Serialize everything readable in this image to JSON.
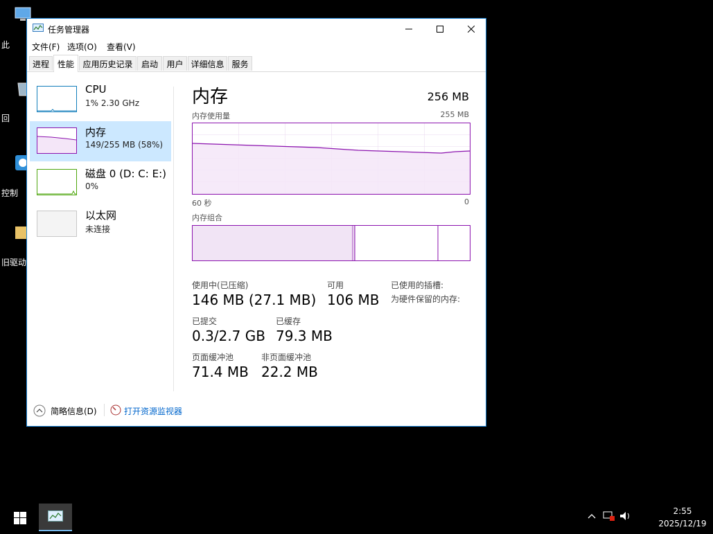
{
  "desktop": {
    "icons": [
      {
        "label": "此"
      },
      {
        "label": "回"
      },
      {
        "label": "控制"
      },
      {
        "label": "旧驱动"
      }
    ]
  },
  "window": {
    "title": "任务管理器",
    "menu": [
      "文件(F)",
      "选项(O)",
      "查看(V)"
    ],
    "tabs": [
      "进程",
      "性能",
      "应用历史记录",
      "启动",
      "用户",
      "详细信息",
      "服务"
    ],
    "active_tab": "性能"
  },
  "sidebar": {
    "items": [
      {
        "name": "CPU",
        "sub": "1% 2.30 GHz"
      },
      {
        "name": "内存",
        "sub": "149/255 MB (58%)"
      },
      {
        "name": "磁盘 0 (D: C: E:)",
        "sub": "0%"
      },
      {
        "name": "以太网",
        "sub": "未连接"
      }
    ]
  },
  "main": {
    "title": "内存",
    "total": "256 MB",
    "usage_label": "内存使用量",
    "usage_max": "255 MB",
    "time_left": "60 秒",
    "time_right": "0",
    "composition_label": "内存组合",
    "stats": {
      "in_use_label": "使用中(已压缩)",
      "in_use_value": "146 MB (27.1 MB)",
      "available_label": "可用",
      "available_value": "106 MB",
      "slots_label": "已使用的插槽:",
      "reserved_label": "为硬件保留的内存:",
      "committed_label": "已提交",
      "committed_value": "0.3/2.7 GB",
      "cached_label": "已缓存",
      "cached_value": "79.3 MB",
      "paged_label": "页面缓冲池",
      "paged_value": "71.4 MB",
      "nonpaged_label": "非页面缓冲池",
      "nonpaged_value": "22.2 MB"
    }
  },
  "footer": {
    "brief": "简略信息(D)",
    "monitor": "打开资源监视器"
  },
  "taskbar": {
    "time": "2:55",
    "date": "2025/12/19"
  },
  "colors": {
    "memory": "#8b12ae",
    "cpu": "#117dbb",
    "disk": "#4da60c",
    "accent": "#1883d7",
    "link": "#0066cc"
  }
}
